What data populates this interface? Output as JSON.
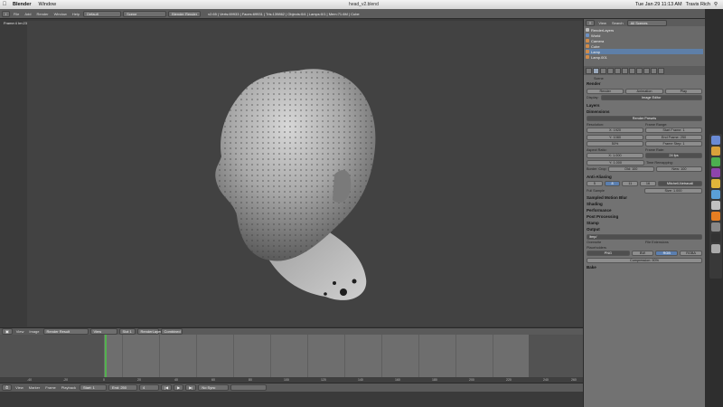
{
  "menubar": {
    "apple": "",
    "app_name": "Blender",
    "window": "Window",
    "clock": "Tue Jan 29  11:13 AM",
    "user": "Travis Rich"
  },
  "window_title": "head_v2.blend",
  "top_header": {
    "menus": [
      "File",
      "Add",
      "Render",
      "Window",
      "Help"
    ],
    "layout": "Default",
    "scene": "Scene",
    "engine": "Blender Render",
    "stats": "v2.65 | Verts:69933 | Faces:69931 | Tris:139862 | Objects:0/4 | Lamps:0/1 | Mem:71.6M | Cube"
  },
  "viewport": {
    "frame_info": "Frame:4 Im:23:069918 Ve:140211360 | La:2 Mem:71.60M (54.43M, peak 8355.49M) Time:02:01.08"
  },
  "image_header": {
    "view": "View",
    "image": "Image",
    "render_result": "Render Result",
    "view2": "View",
    "slot": "Slot 1",
    "layer": "RenderLayer",
    "combined": "Combined"
  },
  "timeline": {
    "ticks": [
      "-40",
      "-20",
      "0",
      "20",
      "40",
      "60",
      "80",
      "100",
      "120",
      "140",
      "160",
      "180",
      "200",
      "220",
      "240",
      "260"
    ]
  },
  "tl_header": {
    "view": "View",
    "marker": "Marker",
    "frame": "Frame",
    "playback": "Playback",
    "start": "Start: 1",
    "end": "End: 250",
    "current": "4",
    "sync": "No Sync"
  },
  "outliner": {
    "view": "View",
    "search": "Search",
    "scenes": "All Scenes",
    "items": [
      "RenderLayers",
      "World",
      "Camera",
      "Cube",
      "Lamp",
      "Lamp.001"
    ]
  },
  "props": {
    "scene_label": "Scene",
    "render_section": "Render",
    "render_btn": "Render",
    "animation_btn": "Animation",
    "play_btn": "Play",
    "display_label": "Display:",
    "display_value": "Image Editor",
    "layers_section": "Layers",
    "dimensions_section": "Dimensions",
    "presets": "Render Presets",
    "resolution_label": "Resolution:",
    "res_x": "X: 1920",
    "res_y": "Y: 1080",
    "res_pct": "50%",
    "frame_range_label": "Frame Range:",
    "start_frame": "Start Frame: 1",
    "end_frame": "End Frame: 250",
    "frame_step": "Frame Step: 1",
    "aspect_label": "Aspect Ratio:",
    "aspect_x": "X: 1.000",
    "aspect_y": "Y: 1.000",
    "frame_rate_label": "Frame Rate:",
    "frame_rate": "24 fps",
    "border": "Border",
    "crop": "Crop",
    "time_remap_label": "Time Remapping:",
    "old": "Old: 100",
    "new": "New: 100",
    "aa_section": "Anti-Aliasing",
    "aa_5": "5",
    "aa_8": "8",
    "aa_11": "11",
    "aa_16": "16",
    "filter": "Mitchell-Netravali",
    "full_sample": "Full Sample",
    "size": "Size: 1.000",
    "motion_blur": "Sampled Motion Blur",
    "shading": "Shading",
    "performance": "Performance",
    "post_processing": "Post Processing",
    "stamp": "Stamp",
    "output_section": "Output",
    "output_path": "/tmp/",
    "overwrite": "Overwrite",
    "file_ext": "File Extensions",
    "placeholders": "Placeholders",
    "format": "PNG",
    "bw": "BW",
    "rgb": "RGB",
    "rgba": "RGBA",
    "compression": "Compression: 90%",
    "bake_section": "Bake"
  },
  "colors": {
    "accent_blue": "#5b7fb0",
    "timeline_cursor": "#53b24f"
  }
}
